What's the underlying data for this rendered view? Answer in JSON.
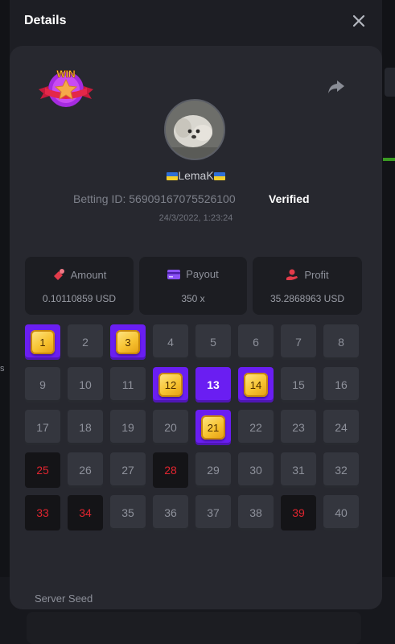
{
  "background": {
    "left_edge_text": "s"
  },
  "modal": {
    "title": "Details",
    "close_icon": "close-icon"
  },
  "bet": {
    "badge": "WIN",
    "username": "LemaK",
    "betting_label": "Betting ID:",
    "betting_id": "56909167075526100",
    "verified": "Verified",
    "timestamp": "24/3/2022, 1:23:24"
  },
  "stats": {
    "amount": {
      "label": "Amount",
      "value": "0.10110859 USD",
      "icon": "money-icon"
    },
    "payout": {
      "label": "Payout",
      "value": "350 x",
      "icon": "card-icon"
    },
    "profit": {
      "label": "Profit",
      "value": "35.2868963 USD",
      "icon": "hand-coin-icon"
    }
  },
  "grid": {
    "cells": [
      {
        "n": "1",
        "state": "hit"
      },
      {
        "n": "2",
        "state": "none"
      },
      {
        "n": "3",
        "state": "hit"
      },
      {
        "n": "4",
        "state": "none"
      },
      {
        "n": "5",
        "state": "none"
      },
      {
        "n": "6",
        "state": "none"
      },
      {
        "n": "7",
        "state": "none"
      },
      {
        "n": "8",
        "state": "none"
      },
      {
        "n": "9",
        "state": "none"
      },
      {
        "n": "10",
        "state": "none"
      },
      {
        "n": "11",
        "state": "none"
      },
      {
        "n": "12",
        "state": "hit"
      },
      {
        "n": "13",
        "state": "picked"
      },
      {
        "n": "14",
        "state": "hit"
      },
      {
        "n": "15",
        "state": "none"
      },
      {
        "n": "16",
        "state": "none"
      },
      {
        "n": "17",
        "state": "none"
      },
      {
        "n": "18",
        "state": "none"
      },
      {
        "n": "19",
        "state": "none"
      },
      {
        "n": "20",
        "state": "none"
      },
      {
        "n": "21",
        "state": "hit"
      },
      {
        "n": "22",
        "state": "none"
      },
      {
        "n": "23",
        "state": "none"
      },
      {
        "n": "24",
        "state": "none"
      },
      {
        "n": "25",
        "state": "loss"
      },
      {
        "n": "26",
        "state": "none"
      },
      {
        "n": "27",
        "state": "none"
      },
      {
        "n": "28",
        "state": "loss"
      },
      {
        "n": "29",
        "state": "none"
      },
      {
        "n": "30",
        "state": "none"
      },
      {
        "n": "31",
        "state": "none"
      },
      {
        "n": "32",
        "state": "none"
      },
      {
        "n": "33",
        "state": "loss"
      },
      {
        "n": "34",
        "state": "loss"
      },
      {
        "n": "35",
        "state": "none"
      },
      {
        "n": "36",
        "state": "none"
      },
      {
        "n": "37",
        "state": "none"
      },
      {
        "n": "38",
        "state": "none"
      },
      {
        "n": "39",
        "state": "loss"
      },
      {
        "n": "40",
        "state": "none"
      }
    ]
  },
  "server_seed": {
    "label": "Server Seed"
  },
  "colors": {
    "accent": "#6a1ef2",
    "loss": "#e0252f",
    "gem": "#f7c331"
  }
}
